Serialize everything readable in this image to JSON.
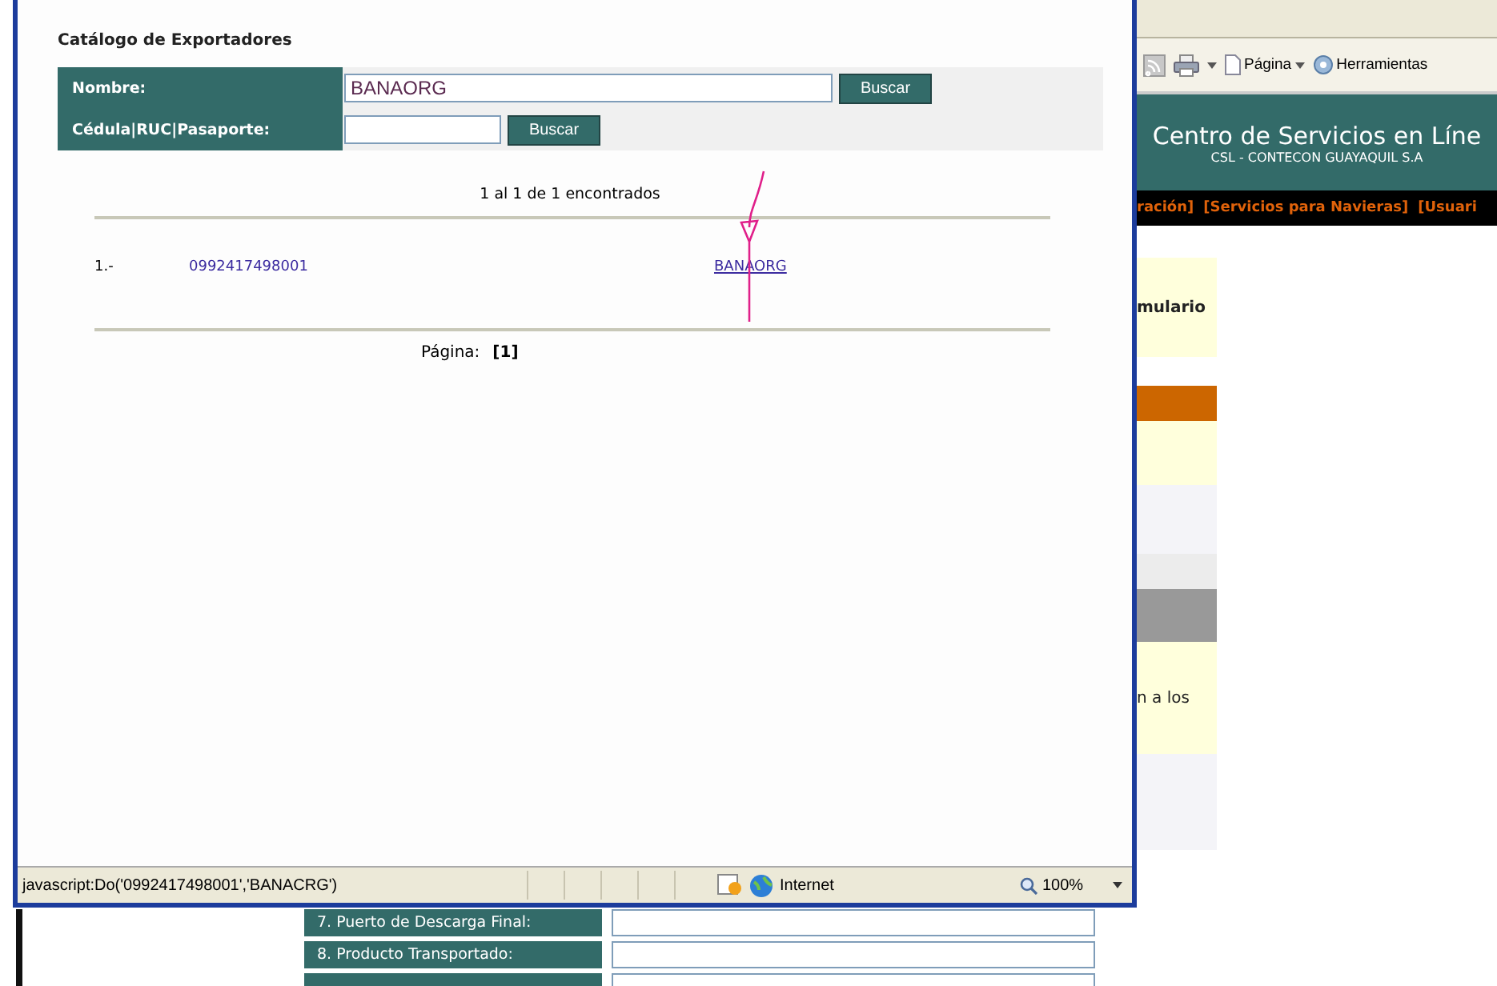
{
  "background_page": {
    "toolbar": [
      {
        "kind": "feed"
      },
      {
        "kind": "print"
      },
      {
        "kind": "page",
        "label": "Página"
      },
      {
        "kind": "tools",
        "label": "Herramientas"
      }
    ],
    "header": {
      "title": "Centro de Servicios en Líne",
      "subtitle": "CSL - CONTECON GUAYAQUIL S.A"
    },
    "nav": [
      "ración]",
      "[Servicios para Navieras]",
      "[Usuari"
    ],
    "side_texts": [
      "mulario",
      "n a los"
    ],
    "form_rows": [
      {
        "label": "7. Puerto de Descarga Final:"
      },
      {
        "label": "8. Producto Transportado:"
      }
    ]
  },
  "popup": {
    "title": "Catálogo de Exportadores",
    "search_rows": [
      {
        "label": "Nombre:",
        "value": "BANAORG",
        "button": "Buscar"
      },
      {
        "label": "Cédula|RUC|Pasaporte:",
        "button": "Buscar"
      }
    ],
    "results_summary": "1 al 1 de 1 encontrados",
    "results": [
      {
        "number": "1.-",
        "id": "0992417498001",
        "name": "BANAORG"
      }
    ],
    "pagination": {
      "label": "Página:",
      "current": "[1]"
    },
    "status_bar": {
      "url": "javascript:Do('0992417498001','BANACRG')",
      "zone": "Internet",
      "zoom": "100%"
    }
  }
}
